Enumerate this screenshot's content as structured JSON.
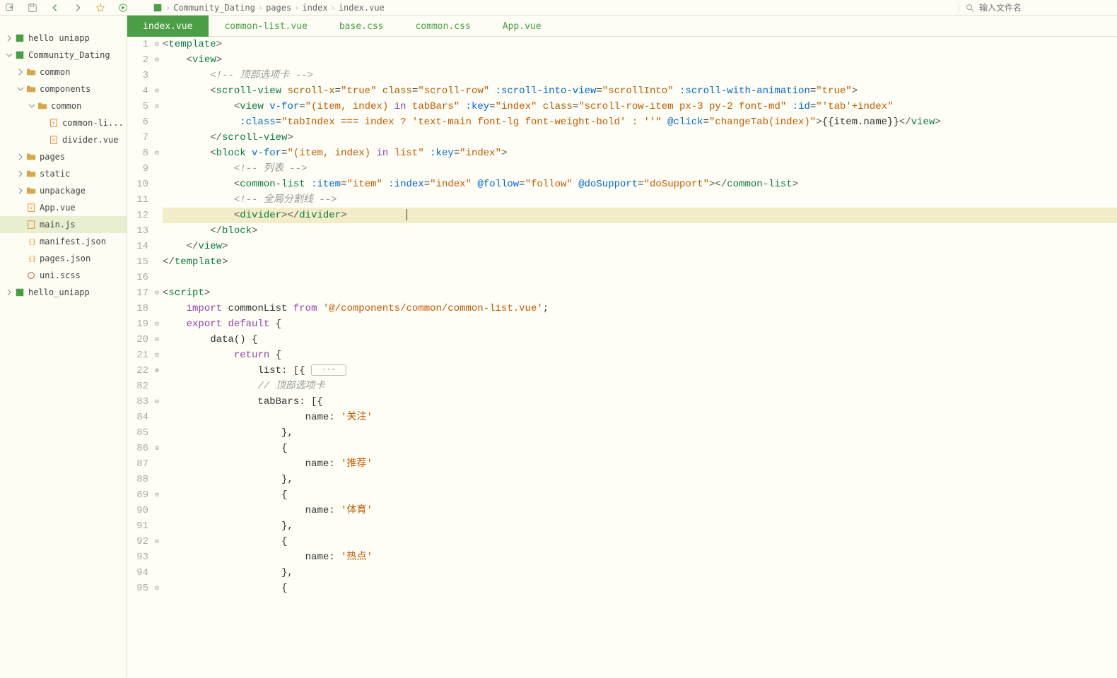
{
  "toolbar": {
    "search_placeholder": "输入文件名"
  },
  "breadcrumb": [
    "Community_Dating",
    "pages",
    "index",
    "index.vue"
  ],
  "tree": {
    "items": [
      {
        "label": "hello uniapp",
        "type": "project",
        "depth": 0,
        "expanded": false
      },
      {
        "label": "Community_Dating",
        "type": "project",
        "depth": 0,
        "expanded": true
      },
      {
        "label": "common",
        "type": "folder",
        "depth": 1,
        "expanded": false
      },
      {
        "label": "components",
        "type": "folder",
        "depth": 1,
        "expanded": true
      },
      {
        "label": "common",
        "type": "folder",
        "depth": 2,
        "expanded": true
      },
      {
        "label": "common-li...",
        "type": "vue",
        "depth": 3
      },
      {
        "label": "divider.vue",
        "type": "vue",
        "depth": 3
      },
      {
        "label": "pages",
        "type": "folder",
        "depth": 1,
        "expanded": false
      },
      {
        "label": "static",
        "type": "folder",
        "depth": 1,
        "expanded": false
      },
      {
        "label": "unpackage",
        "type": "folder",
        "depth": 1,
        "expanded": false
      },
      {
        "label": "App.vue",
        "type": "vue",
        "depth": 1
      },
      {
        "label": "main.js",
        "type": "js",
        "depth": 1,
        "selected": true
      },
      {
        "label": "manifest.json",
        "type": "json",
        "depth": 1
      },
      {
        "label": "pages.json",
        "type": "json",
        "depth": 1
      },
      {
        "label": "uni.scss",
        "type": "scss",
        "depth": 1
      },
      {
        "label": "hello_uniapp",
        "type": "project",
        "depth": 0,
        "expanded": false
      }
    ]
  },
  "tabs": [
    {
      "label": "index.vue",
      "active": true
    },
    {
      "label": "common-list.vue"
    },
    {
      "label": "base.css"
    },
    {
      "label": "common.css"
    },
    {
      "label": "App.vue"
    }
  ],
  "code": {
    "comment_topTab": "顶部选项卡",
    "comment_list": "列表",
    "comment_divider": "全局分割线",
    "comment_topTab2": "// 顶部选项卡",
    "import_path": "'@/components/common/common-list.vue'",
    "fold_pill": "···",
    "tabBar_names": [
      "关注",
      "推荐",
      "体育",
      "热点"
    ]
  },
  "line_numbers": [
    "1",
    "2",
    "3",
    "4",
    "5",
    "6",
    "7",
    "8",
    "9",
    "10",
    "11",
    "12",
    "13",
    "14",
    "15",
    "16",
    "17",
    "18",
    "19",
    "20",
    "21",
    "22",
    "82",
    "83",
    "84",
    "85",
    "86",
    "87",
    "88",
    "89",
    "90",
    "91",
    "92",
    "93",
    "94",
    "95"
  ],
  "fold_marks": [
    "⊟",
    "⊟",
    "",
    "⊟",
    "⊟",
    "",
    "",
    "⊟",
    "",
    "",
    "",
    "",
    "",
    "",
    "",
    "",
    "⊟",
    "",
    "⊟",
    "⊟",
    "⊟",
    "⊞",
    "",
    "⊟",
    "",
    "",
    "⊟",
    "",
    "",
    "⊟",
    "",
    "",
    "⊟",
    "",
    "",
    "⊟"
  ]
}
